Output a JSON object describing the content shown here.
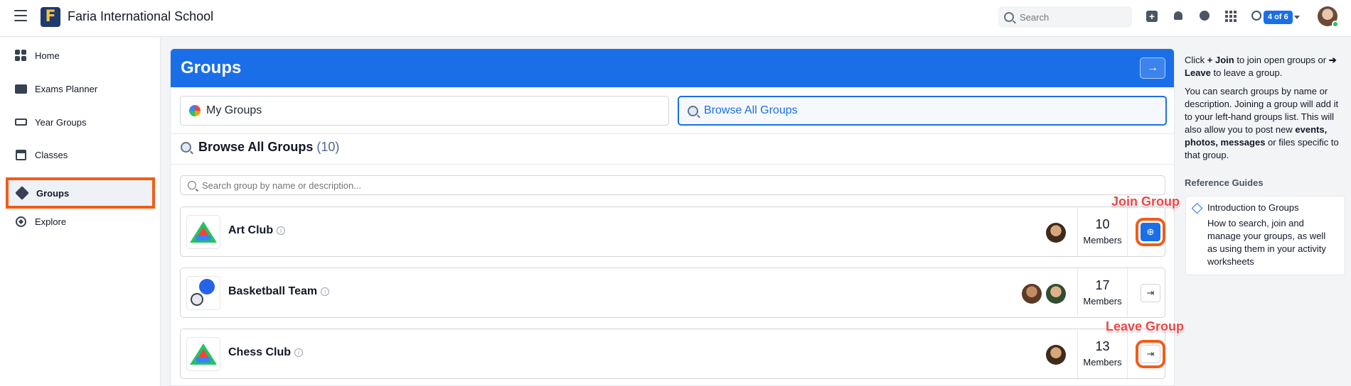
{
  "topbar": {
    "app_title": "Faria International School",
    "search_placeholder": "Search",
    "pager": "4 of 6"
  },
  "sidebar": {
    "items": [
      {
        "label": "Home",
        "icon": "home-grid-icon"
      },
      {
        "label": "Exams Planner",
        "icon": "folder-icon"
      },
      {
        "label": "Year Groups",
        "icon": "year-groups-icon"
      },
      {
        "label": "Classes",
        "icon": "classes-icon"
      },
      {
        "label": "Groups",
        "icon": "cube-icon",
        "active": true
      },
      {
        "label": "Explore",
        "icon": "compass-icon"
      }
    ]
  },
  "main": {
    "title": "Groups",
    "header_button": "→",
    "tabs": [
      {
        "label": "My Groups",
        "icon": "multicolor-icon"
      },
      {
        "label": "Browse All Groups",
        "icon": "magnifier-icon",
        "active": true
      }
    ],
    "section_title": "Browse All Groups",
    "section_count": "(10)",
    "group_search_placeholder": "Search group by name or description...",
    "members_label": "Members",
    "groups": [
      {
        "name": "Art Club",
        "members": "10",
        "action": "join",
        "action_glyph": "⊕"
      },
      {
        "name": "Basketball Team",
        "members": "17",
        "action": "leave",
        "action_glyph": "⇥"
      },
      {
        "name": "Chess Club",
        "members": "13",
        "action": "leave",
        "action_glyph": "⇥"
      }
    ]
  },
  "callouts": {
    "join": "Join Group",
    "leave": "Leave Group"
  },
  "help": {
    "p1_a": "Click ",
    "p1_join": "+ Join",
    "p1_b": " to join open groups or ",
    "p1_leave": "➔ Leave",
    "p1_c": " to leave a group.",
    "p2_a": "You can search groups by name or description. Joining a group will add it to your left-hand groups list. This will also allow you to post new ",
    "p2_bold": "events, photos, messages",
    "p2_b": " or files specific to that group.",
    "reference_title": "Reference Guides",
    "guide_title": "Introduction to Groups",
    "guide_desc": "How to search, join and manage your groups, as well as using them in your activity worksheets"
  },
  "colors": {
    "accent": "#1a6fe8",
    "highlight": "#f25c19",
    "callout_text": "#ef4444"
  }
}
